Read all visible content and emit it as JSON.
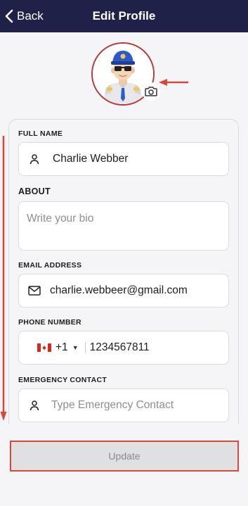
{
  "header": {
    "back_label": "Back",
    "title": "Edit Profile"
  },
  "form": {
    "full_name": {
      "label": "FULL NAME",
      "value": "Charlie Webber"
    },
    "about": {
      "label": "ABOUT",
      "placeholder": "Write your bio"
    },
    "email": {
      "label": "EMAIL ADDRESS",
      "value": "charlie.webbeer@gmail.com"
    },
    "phone": {
      "label": "PHONE NUMBER",
      "country_code": "+1",
      "value": "1234567811",
      "country_flag": "canada-flag-icon"
    },
    "emergency": {
      "label": "EMERGENCY CONTACT",
      "placeholder": "Type Emergency Contact"
    }
  },
  "actions": {
    "update_label": "Update"
  },
  "colors": {
    "header_bg": "#1f2148",
    "annotation_red": "#d9473c",
    "avatar_ring": "#b33a3a"
  }
}
